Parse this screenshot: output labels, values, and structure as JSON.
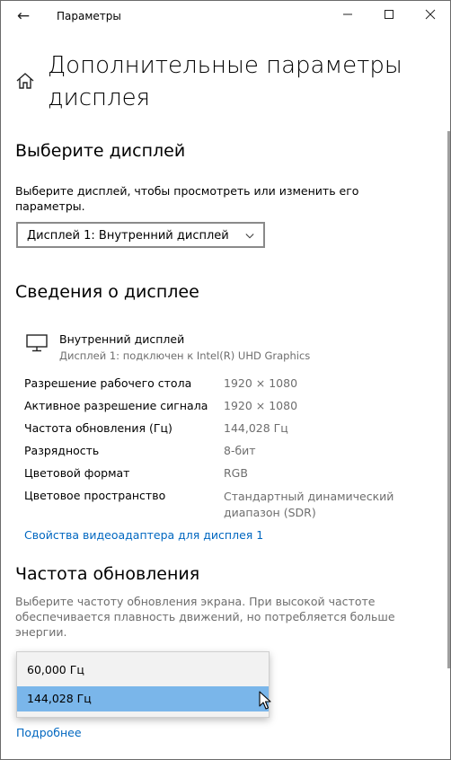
{
  "titlebar": {
    "back_icon": "←",
    "title": "Параметры",
    "minimize_icon": "—",
    "maximize_icon": "☐",
    "close_icon": "✕"
  },
  "page": {
    "title_line1": "Дополнительные параметры",
    "title_line2": "дисплея"
  },
  "select_display": {
    "heading": "Выберите дисплей",
    "description_line1": "Выберите дисплей, чтобы просмотреть или изменить его",
    "description_line2": "параметры.",
    "dropdown_value": "Дисплей 1: Внутренний дисплей"
  },
  "display_info": {
    "heading": "Сведения о дисплее",
    "display_name": "Внутренний дисплей",
    "display_subtitle": "Дисплей 1: подключен к Intel(R) UHD Graphics",
    "rows": [
      {
        "label": "Разрешение рабочего стола",
        "value": "1920 × 1080"
      },
      {
        "label": "Активное разрешение сигнала",
        "value": "1920 × 1080"
      },
      {
        "label": "Частота обновления (Гц)",
        "value": "144,028 Гц"
      },
      {
        "label": "Разрядность",
        "value": "8-бит"
      },
      {
        "label": "Цветовой формат",
        "value": "RGB"
      },
      {
        "label": "Цветовое пространство",
        "value_line1": "Стандартный динамический",
        "value_line2": "диапазон (SDR)"
      }
    ],
    "adapter_link": "Свойства видеоадаптера для дисплея 1"
  },
  "refresh_rate": {
    "heading": "Частота обновления",
    "description_line1": "Выберите частоту обновления экрана. При высокой частоте",
    "description_line2": "обеспечивается плавность движений, но потребляется больше",
    "description_line3": "энергии.",
    "options": [
      "60,000 Гц",
      "144,028 Гц"
    ],
    "selected_option": "144,028 Гц"
  },
  "more_link": "Подробнее",
  "colors": {
    "accent_link": "#0067c0",
    "selected_option_bg": "#7ab6ea"
  }
}
